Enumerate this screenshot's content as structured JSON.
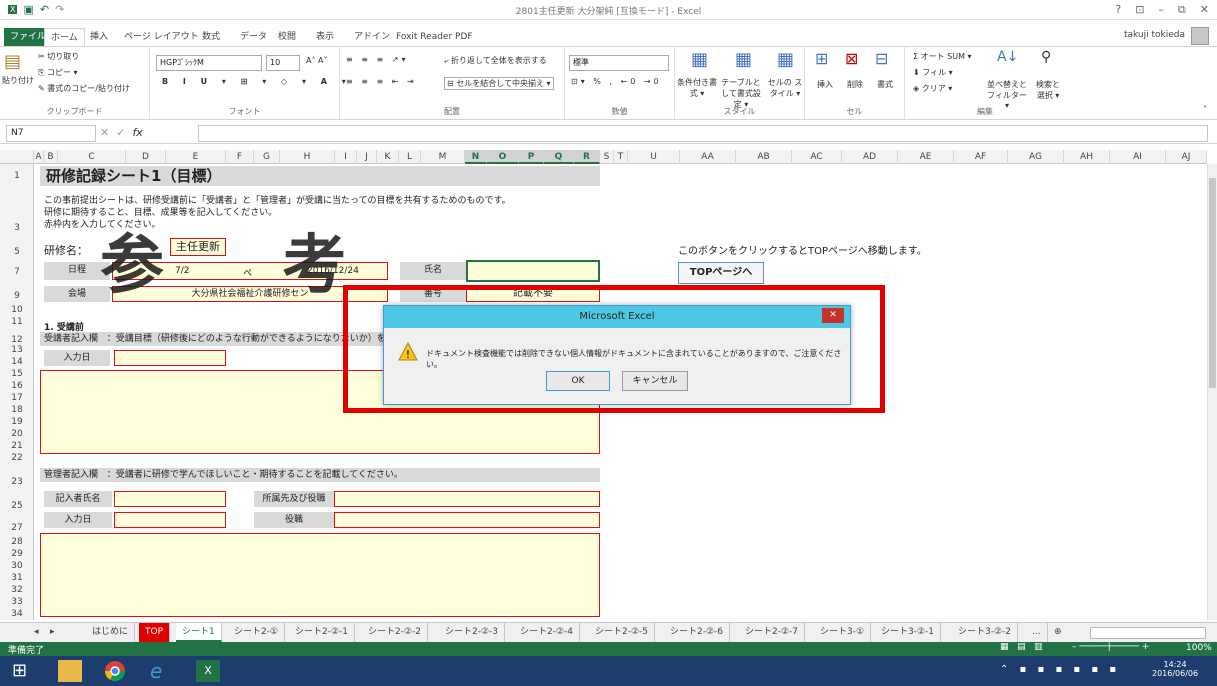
{
  "window": {
    "title": "2801主任更新 大分架純 [互換モード] - Excel",
    "controls": [
      "?",
      "⊡",
      "–",
      "⧉",
      "✕"
    ]
  },
  "ribbon_tabs": [
    "ファイル",
    "ホーム",
    "挿入",
    "ページ レイアウト",
    "数式",
    "データ",
    "校閲",
    "表示",
    "アドイン",
    "Foxit Reader PDF"
  ],
  "user": "takuji tokieda",
  "ribbon": {
    "clipboard": {
      "paste": "貼り付け",
      "cut": "切り取り",
      "copy": "コピー ▾",
      "format_copy": "書式のコピー/貼り付け",
      "label": "クリップボード"
    },
    "font": {
      "name": "HGPｺﾞｼｯｸM",
      "size": "10",
      "label": "フォント"
    },
    "align": {
      "wrap": "折り返して全体を表示する",
      "merge": "セルを結合して中央揃え ▾",
      "label": "配置"
    },
    "number": {
      "format": "標準",
      "label": "数値"
    },
    "style": {
      "cond": "条件付き書式 ▾",
      "table": "テーブルとして書式設定 ▾",
      "cellstyle": "セルの スタイル ▾",
      "label": "スタイル"
    },
    "cells": {
      "insert": "挿入",
      "delete": "削除",
      "format": "書式",
      "label": "セル"
    },
    "edit": {
      "autosum": "オート SUM ▾",
      "fill": "フィル ▾",
      "clear": "クリア ▾",
      "sort": "並べ替えと フィルター ▾",
      "find": "検索と 選択 ▾",
      "label": "編集"
    }
  },
  "formula": {
    "namebox": "N7",
    "fx": "fx",
    "value": ""
  },
  "columns": [
    "A",
    "B",
    "C",
    "D",
    "E",
    "F",
    "G",
    "H",
    "I",
    "J",
    "K",
    "L",
    "M",
    "N",
    "O",
    "P",
    "Q",
    "R",
    "S",
    "T",
    "U",
    "AA",
    "AB",
    "AC",
    "AD",
    "AE",
    "AF",
    "AG",
    "AH",
    "AI",
    "AJ"
  ],
  "rows": [
    "1",
    "2",
    "3",
    "",
    "5",
    "",
    "7",
    "",
    "9",
    "10",
    "11",
    "12",
    "13",
    "14",
    "15",
    "16",
    "17",
    "18",
    "19",
    "20",
    "21",
    "22",
    "",
    "23",
    "",
    "25",
    "",
    "27",
    "28",
    "29",
    "30",
    "31",
    "32",
    "33",
    "34",
    "35"
  ],
  "sheet": {
    "title": "研修記録シート1（目標）",
    "intro": [
      "この事前提出シートは、研修受講前に「受講者」と「管理者」が受講に当たっての目標を共有するためのものです。",
      "研修に期待すること、目標、成果等を記入してください。",
      "赤枠内を入力してください。"
    ],
    "course_label": "研修名：",
    "course_value": "主任更新",
    "watermark": "参 考",
    "date_label": "日程",
    "date_value": "7/2",
    "page_label": "ペ",
    "date2": "2016/12/24",
    "name_label": "氏名",
    "venue_label": "会場",
    "venue_value": "大分県社会福祉介護研修セン",
    "number_label": "番号",
    "number_value": "記載不要",
    "top_hint": "このボタンをクリックするとTOPページへ移動します。",
    "top_button": "TOPページへ",
    "section1": "1. 受講前",
    "trainee_label": "受講者記入欄",
    "trainee_desc": "：受講目標（研修後にどのような行動ができるようになりたいか）を記",
    "entry_date": "入力日",
    "manager_label": "管理者記入欄",
    "manager_desc": "：受講者に研修で学んでほしいこと・期待することを記載してください。",
    "writer_name": "記入者氏名",
    "dept": "所属先及び役職",
    "entry_date2": "入力日",
    "role": "役職"
  },
  "dialog": {
    "title": "Microsoft Excel",
    "message": "ドキュメント検査機能では削除できない個人情報がドキュメントに含まれていることがありますので、ご注意ください。",
    "ok": "OK",
    "cancel": "キャンセル"
  },
  "sheet_tabs": [
    "はじめに",
    "TOP",
    "シート1",
    "シート2-①",
    "シート2-②-1",
    "シート2-②-2",
    "シート2-②-3",
    "シート2-②-4",
    "シート2-②-5",
    "シート2-②-6",
    "シート2-②-7",
    "シート3-①",
    "シート3-②-1",
    "シート3-②-2",
    "..."
  ],
  "status": {
    "ready": "準備完了",
    "zoom": "100%"
  },
  "taskbar": {
    "time": "14:24",
    "date": "2016/06/06"
  },
  "colors": {
    "excel_green": "#217346",
    "red": "#e00000",
    "cell_fill": "#ffffdc"
  }
}
